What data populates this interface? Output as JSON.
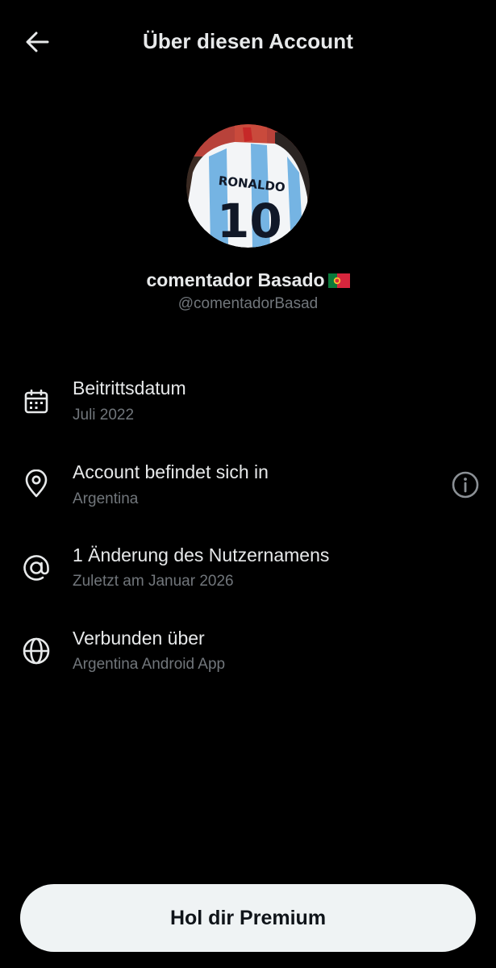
{
  "header": {
    "title": "Über diesen Account",
    "back_icon": "arrow-left-icon"
  },
  "profile": {
    "display_name": "comentador Basado",
    "flag_icon": "portugal-flag-icon",
    "handle": "@comentadorBasad",
    "avatar_shirt_text": "RONALDO",
    "avatar_shirt_number": "10"
  },
  "info": {
    "joined": {
      "title": "Beitrittsdatum",
      "value": "Juli 2022",
      "icon": "calendar-icon"
    },
    "location": {
      "title": "Account befindet sich in",
      "value": "Argentina",
      "icon": "location-pin-icon",
      "action_icon": "info-icon"
    },
    "username_changes": {
      "title": "1 Änderung des Nutzernamens",
      "value": "Zuletzt am Januar 2026",
      "icon": "at-sign-icon"
    },
    "connected": {
      "title": "Verbunden über",
      "value": "Argentina Android App",
      "icon": "globe-icon"
    }
  },
  "premium_button": {
    "label": "Hol dir Premium"
  },
  "colors": {
    "background": "#000000",
    "text_primary": "#e7e9ea",
    "text_secondary": "#71767b",
    "button_bg": "#eff3f4",
    "button_text": "#0f1419"
  }
}
